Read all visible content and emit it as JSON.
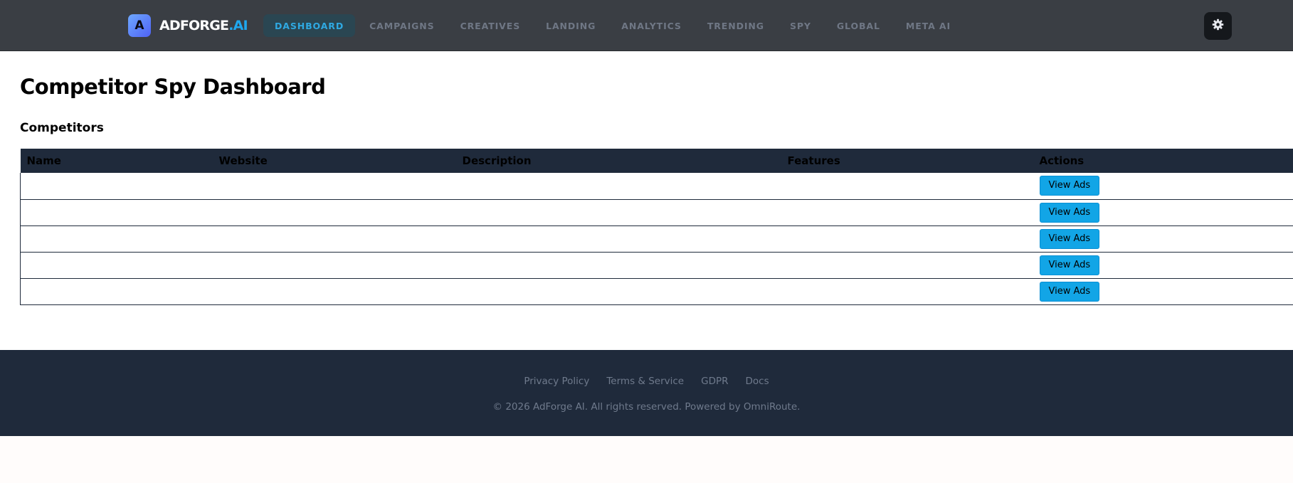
{
  "brand": {
    "logo_letter": "A",
    "name_main": "ADFORGE",
    "name_accent": ".AI"
  },
  "nav": {
    "items": [
      {
        "label": "DASHBOARD",
        "active": true
      },
      {
        "label": "CAMPAIGNS",
        "active": false
      },
      {
        "label": "CREATIVES",
        "active": false
      },
      {
        "label": "LANDING",
        "active": false
      },
      {
        "label": "ANALYTICS",
        "active": false
      },
      {
        "label": "TRENDING",
        "active": false
      },
      {
        "label": "SPY",
        "active": false
      },
      {
        "label": "GLOBAL",
        "active": false
      },
      {
        "label": "META AI",
        "active": false
      }
    ],
    "settings_icon": "gear-icon"
  },
  "main": {
    "title": "Competitor Spy Dashboard",
    "section_title": "Competitors",
    "table": {
      "columns": [
        "Name",
        "Website",
        "Description",
        "Features",
        "Actions"
      ],
      "rows": [
        {
          "name": "",
          "website": "",
          "description": "",
          "features": "",
          "action_label": "View Ads"
        },
        {
          "name": "",
          "website": "",
          "description": "",
          "features": "",
          "action_label": "View Ads"
        },
        {
          "name": "",
          "website": "",
          "description": "",
          "features": "",
          "action_label": "View Ads"
        },
        {
          "name": "",
          "website": "",
          "description": "",
          "features": "",
          "action_label": "View Ads"
        },
        {
          "name": "",
          "website": "",
          "description": "",
          "features": "",
          "action_label": "View Ads"
        }
      ]
    }
  },
  "footer": {
    "links": [
      "Privacy Policy",
      "Terms & Service",
      "GDPR",
      "Docs"
    ],
    "copyright": "© 2026 AdForge AI. All rights reserved. Powered by OmniRoute."
  },
  "colors": {
    "nav_bg": "#3a3e44",
    "accent": "#1fa8f0",
    "table_header_bg": "#1f2a3b",
    "button_bg": "#12a5e6",
    "footer_bg": "#1f2a3b"
  }
}
